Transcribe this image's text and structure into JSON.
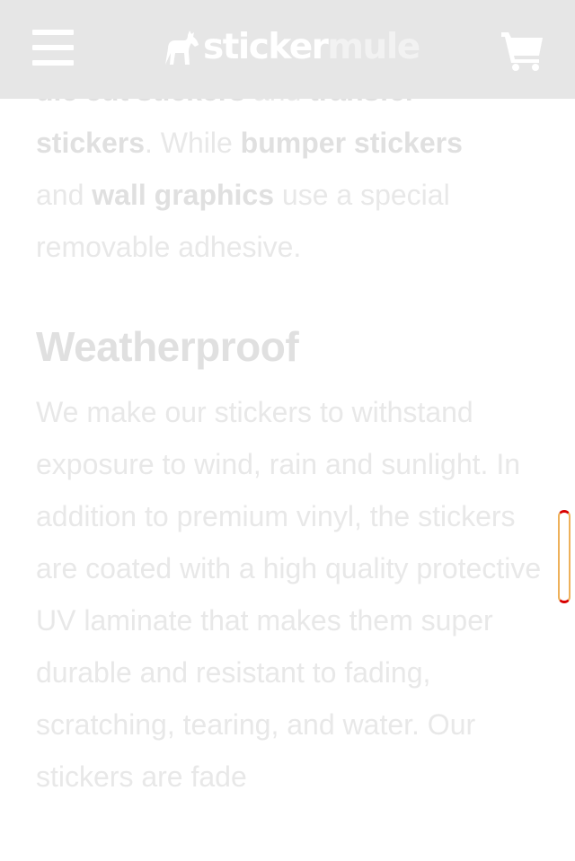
{
  "header": {
    "menu_icon": "hamburger-menu-icon",
    "logo": {
      "part1": "sticker",
      "part2": "mule",
      "icon": "horse-logo-icon"
    },
    "cart_icon": "shopping-cart-icon",
    "background": "#e6e6e6"
  },
  "article": {
    "intro": {
      "line0_links": [
        "die cut stickers",
        "transfer"
      ],
      "line0_and": " and ",
      "transfer_stickers_tail": "stickers",
      "while_text": ". While ",
      "bumper_stickers": "bumper stickers",
      "and_text": "and ",
      "wall_graphics": "wall graphics",
      "tail_text": " use a special removable adhesive."
    },
    "section": {
      "heading": "Weatherproof",
      "body": "We make our stickers to withstand exposure to wind, rain and sunlight. In addition to premium vinyl, the stickers are coated with a high quality protective UV laminate that makes them super durable and resistant to fading, scratching, tearing, and water. Our stickers are fade"
    }
  },
  "colors": {
    "text": "#e8e8e8",
    "scroll_indicator_outline": "#d80000",
    "scroll_indicator_side": "#eeb15a"
  }
}
